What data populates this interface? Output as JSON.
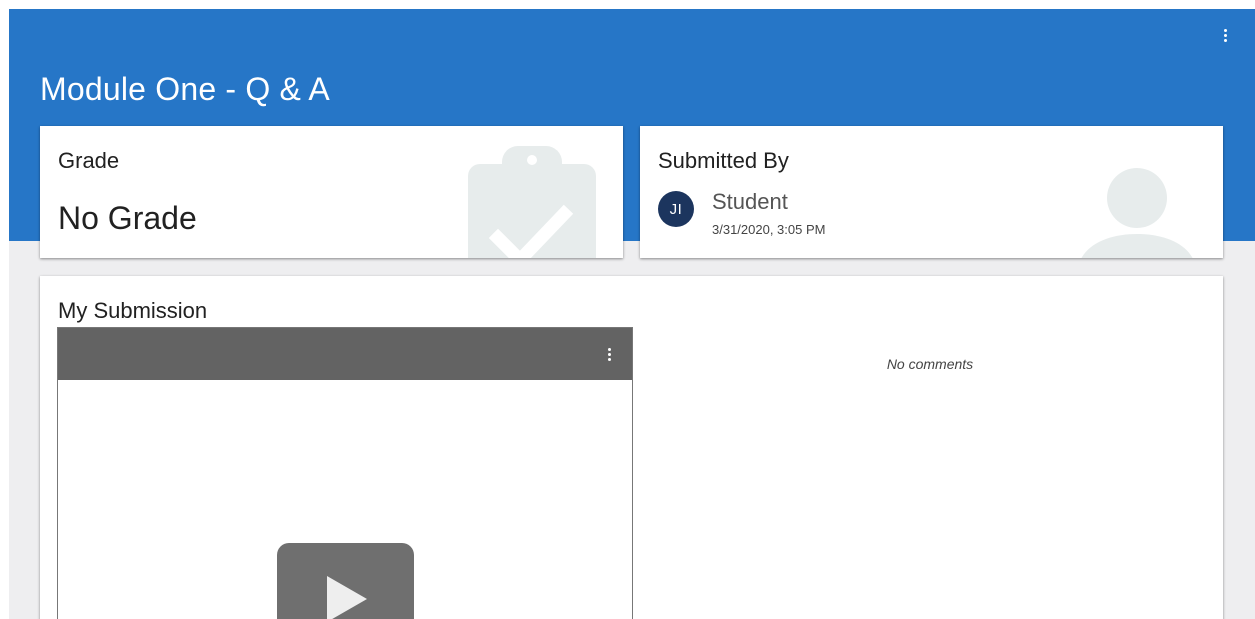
{
  "header": {
    "title": "Module One - Q & A",
    "menu_icon": "more-vert-icon",
    "color": "#2676c7"
  },
  "grade_card": {
    "label": "Grade",
    "value": "No Grade",
    "watermark_icon": "clipboard-check-icon"
  },
  "submitted_card": {
    "label": "Submitted By",
    "avatar_initials": "JI",
    "avatar_color": "#1c355e",
    "name": "Student",
    "date": "3/31/2020, 3:05 PM",
    "watermark_icon": "person-icon"
  },
  "submission": {
    "title": "My Submission",
    "player_menu_icon": "more-vert-icon",
    "play_icon": "play-icon",
    "comments": "No comments"
  }
}
